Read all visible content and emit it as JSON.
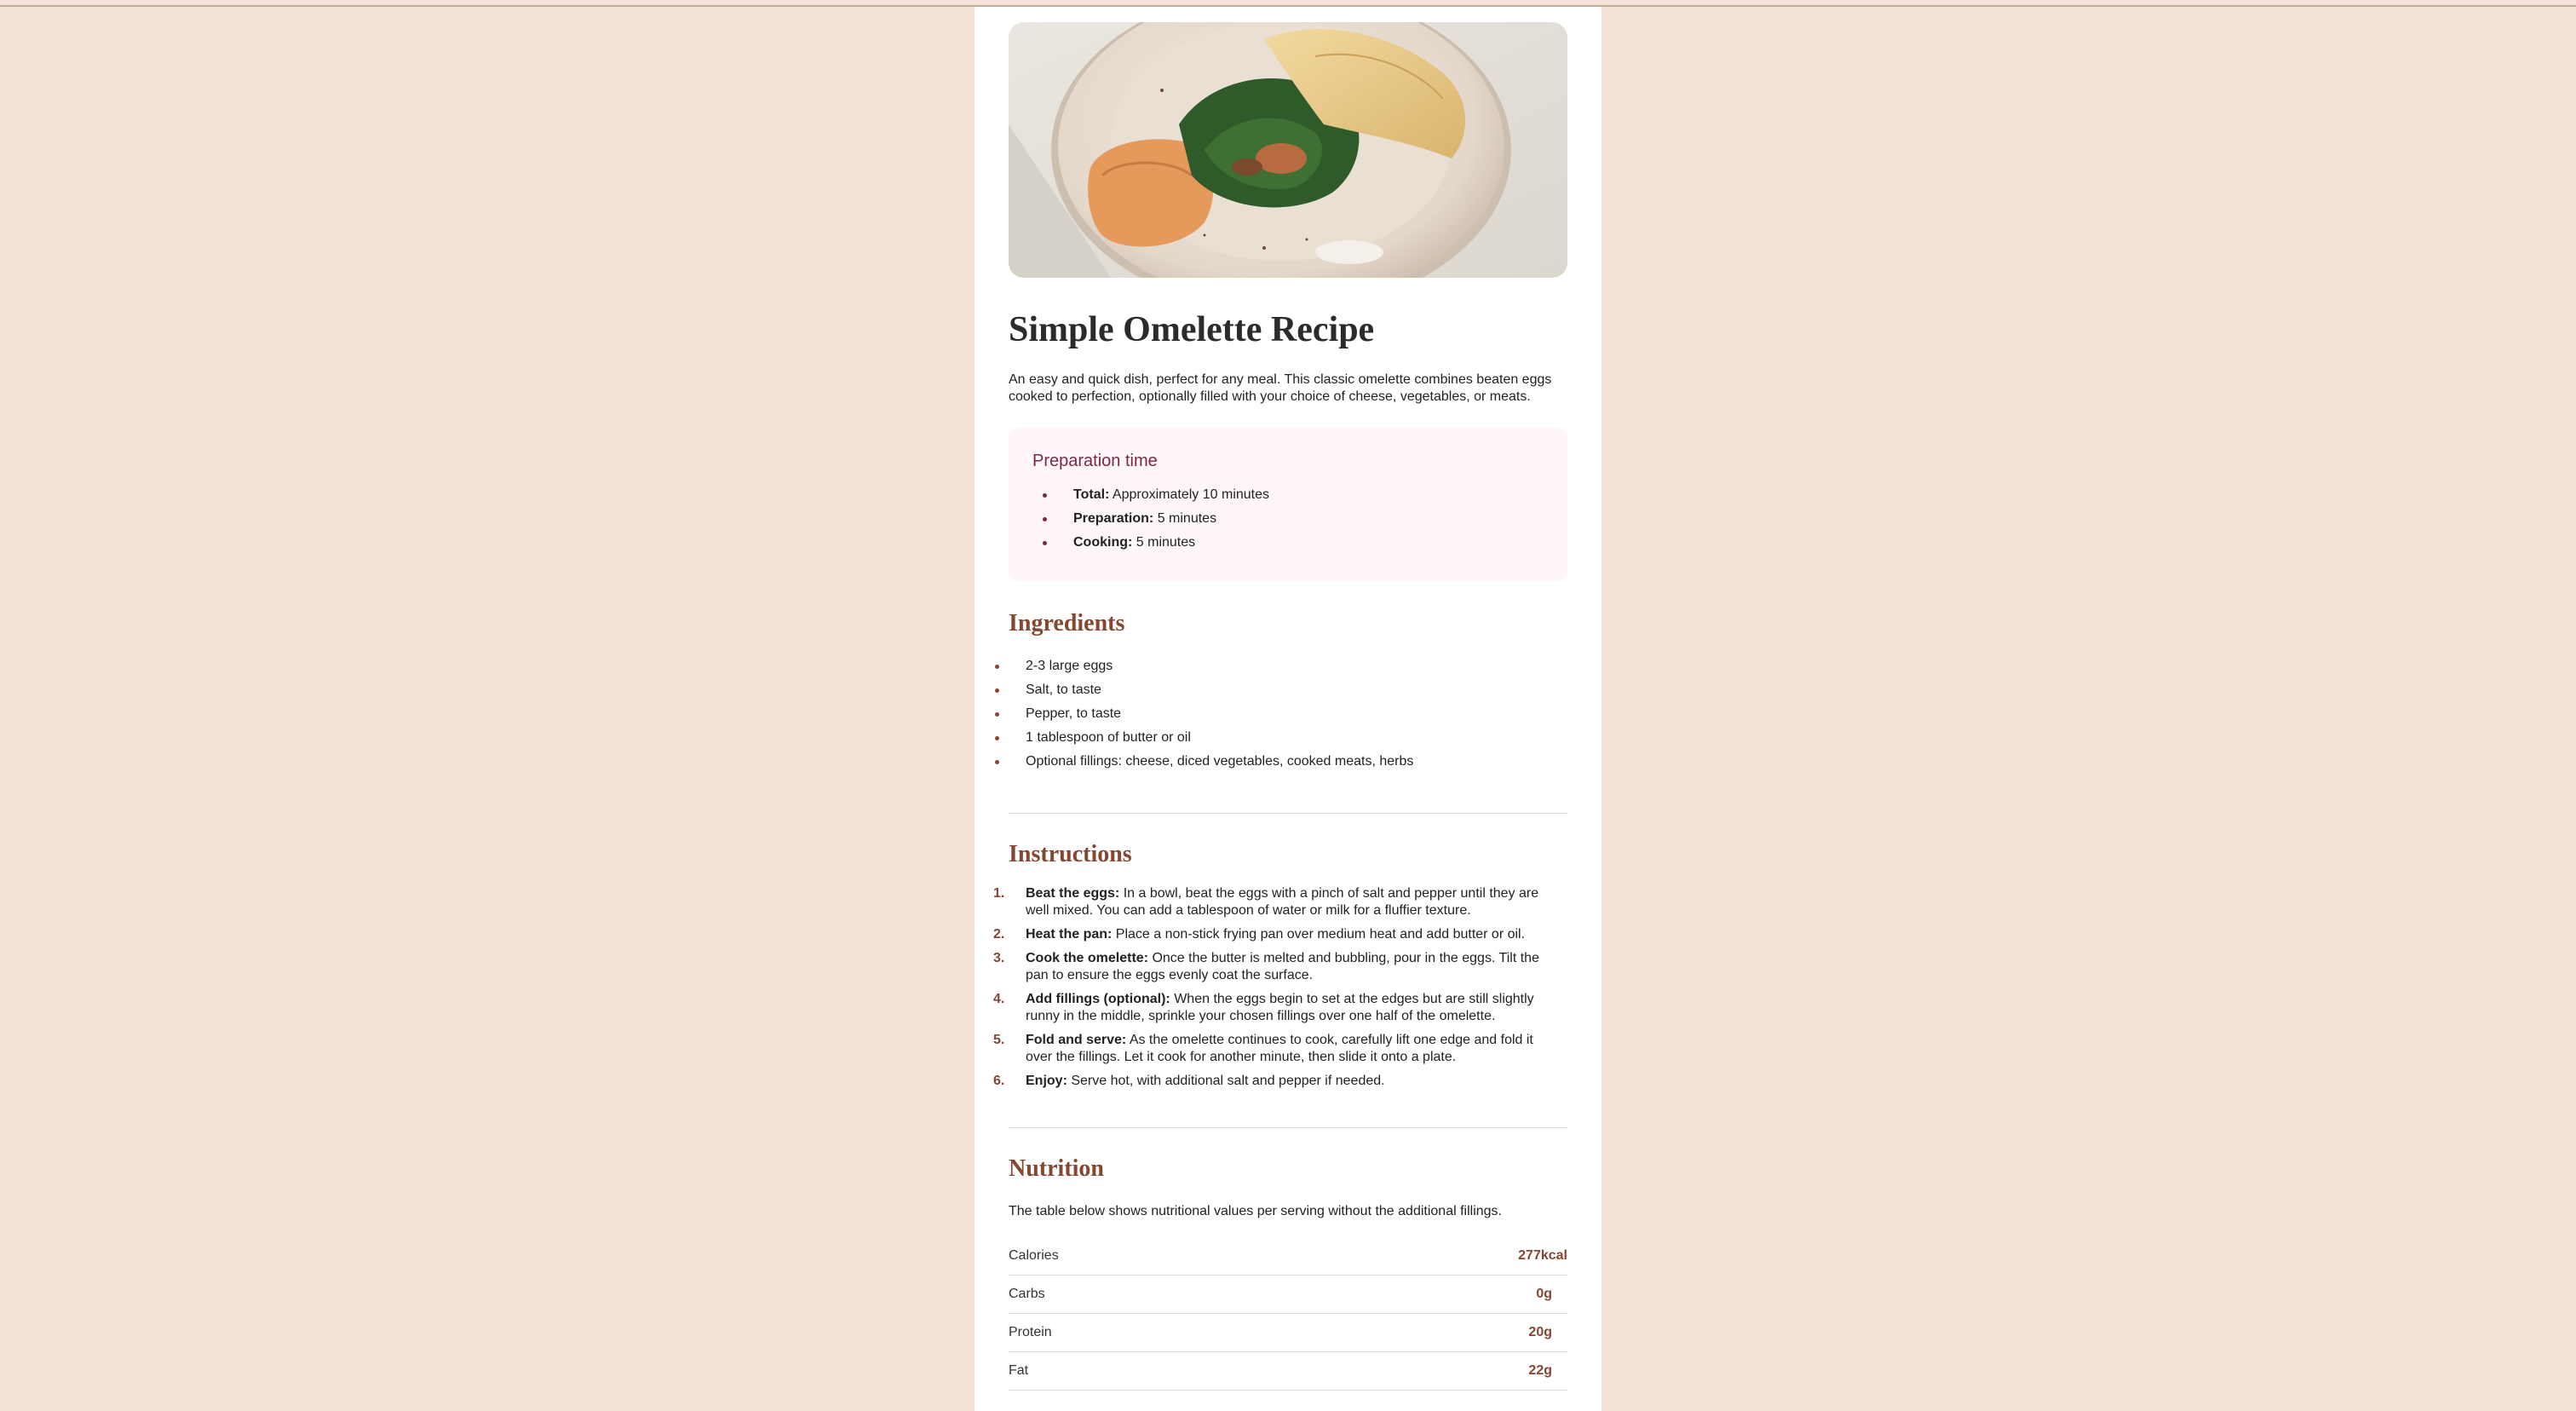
{
  "recipe": {
    "title": "Simple Omelette Recipe",
    "intro": "An easy and quick dish, perfect for any meal. This classic omelette combines beaten eggs cooked to perfection, optionally filled with your choice of cheese, vegetables, or meats.",
    "image_alt": "Omelette on a plate"
  },
  "prep": {
    "heading": "Preparation time",
    "items": [
      {
        "label": "Total:",
        "value": " Approximately 10 minutes"
      },
      {
        "label": "Preparation:",
        "value": " 5 minutes"
      },
      {
        "label": "Cooking:",
        "value": " 5 minutes"
      }
    ]
  },
  "ingredients": {
    "heading": "Ingredients",
    "items": [
      "2-3 large eggs",
      "Salt, to taste",
      "Pepper, to taste",
      "1 tablespoon of butter or oil",
      "Optional fillings: cheese, diced vegetables, cooked meats, herbs"
    ]
  },
  "instructions": {
    "heading": "Instructions",
    "steps": [
      {
        "num": "1.",
        "label": "Beat the eggs:",
        "text": " In a bowl, beat the eggs with a pinch of salt and pepper until they are well mixed. You can add a tablespoon of water or milk for a fluffier texture."
      },
      {
        "num": "2.",
        "label": "Heat the pan:",
        "text": " Place a non-stick frying pan over medium heat and add butter or oil."
      },
      {
        "num": "3.",
        "label": "Cook the omelette:",
        "text": " Once the butter is melted and bubbling, pour in the eggs. Tilt the pan to ensure the eggs evenly coat the surface."
      },
      {
        "num": "4.",
        "label": "Add fillings (optional):",
        "text": " When the eggs begin to set at the edges but are still slightly runny in the middle, sprinkle your chosen fillings over one half of the omelette."
      },
      {
        "num": "5.",
        "label": "Fold and serve:",
        "text": " As the omelette continues to cook, carefully lift one edge and fold it over the fillings. Let it cook for another minute, then slide it onto a plate."
      },
      {
        "num": "6.",
        "label": "Enjoy:",
        "text": " Serve hot, with additional salt and pepper if needed."
      }
    ]
  },
  "nutrition": {
    "heading": "Nutrition",
    "description": "The table below shows nutritional values per serving without the additional fillings.",
    "rows": [
      {
        "name": "Calories",
        "value": "277kcal"
      },
      {
        "name": "Carbs",
        "value": "0g"
      },
      {
        "name": "Protein",
        "value": "20g"
      },
      {
        "name": "Fat",
        "value": "22g"
      }
    ]
  },
  "colors": {
    "page_bg": "#f2e4d9",
    "card_bg": "#ffffff",
    "accent_brown": "#854632",
    "accent_rose": "#7a2848",
    "prep_bg": "#fff6f8"
  }
}
